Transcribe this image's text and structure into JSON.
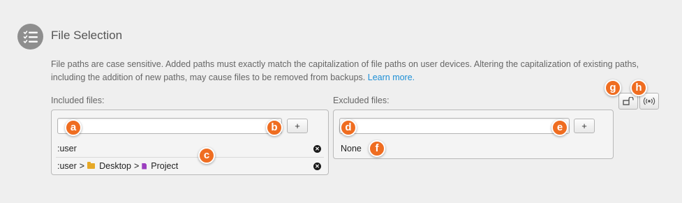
{
  "section": {
    "title": "File Selection",
    "description": "File paths are case sensitive. Added paths must exactly match the capitalization of file paths on user devices. Altering the capitalization of existing paths, including the addition of new paths, may cause files to be removed from backups.",
    "learn_more": "Learn more."
  },
  "included": {
    "label": "Included files:",
    "input_value": "",
    "add_label": "+",
    "rows": [
      {
        "path": ":user"
      },
      {
        "prefix": ":user",
        "sep1": ">",
        "folder": "Desktop",
        "sep2": ">",
        "file": "Project"
      }
    ]
  },
  "excluded": {
    "label": "Excluded files:",
    "input_value": "",
    "add_label": "+",
    "empty_text": "None"
  },
  "toolbar": {
    "lock_icon": "unlock-icon",
    "broadcast_icon": "broadcast-icon"
  },
  "callouts": [
    "a",
    "b",
    "c",
    "d",
    "e",
    "f",
    "g",
    "h"
  ],
  "colors": {
    "callout": "#ef6d21",
    "link": "#1d8fd6",
    "folder": "#e6a928",
    "file": "#9b3fbf"
  }
}
